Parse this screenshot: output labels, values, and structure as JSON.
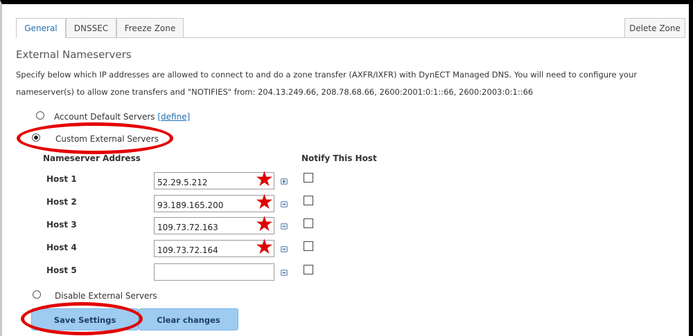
{
  "tabs": [
    {
      "label": "General",
      "active": true
    },
    {
      "label": "DNSSEC",
      "active": false
    },
    {
      "label": "Freeze Zone",
      "active": false
    }
  ],
  "delete_zone_label": "Delete Zone",
  "section": {
    "title": "External Nameservers",
    "description_line1": "Specify below which IP addresses are allowed to connect to and do a zone transfer (AXFR/IXFR) with DynECT Managed DNS. You will need to configure your",
    "description_line2": "nameserver(s) to allow zone transfers and \"NOTIFIES\" from: 204.13.249.66, 208.78.68.66, 2600:2001:0:1::66, 2600:2003:0:1::66"
  },
  "options": {
    "account_default": {
      "label": "Account Default Servers",
      "link": "[define]",
      "checked": false
    },
    "custom_external": {
      "label": "Custom External Servers",
      "checked": true
    },
    "disable_external": {
      "label": "Disable External Servers",
      "checked": false
    }
  },
  "table": {
    "col_address": "Nameserver Address",
    "col_notify": "Notify This Host",
    "hosts": [
      {
        "label": "Host 1",
        "value": "52.29.5.212",
        "icon": "add-icon",
        "notify": false,
        "starred": true
      },
      {
        "label": "Host 2",
        "value": "93.189.165.200",
        "icon": "remove-icon",
        "notify": false,
        "starred": true
      },
      {
        "label": "Host 3",
        "value": "109.73.72.163",
        "icon": "remove-icon",
        "notify": false,
        "starred": true
      },
      {
        "label": "Host 4",
        "value": "109.73.72.164",
        "icon": "remove-icon",
        "notify": false,
        "starred": true
      },
      {
        "label": "Host 5",
        "value": "",
        "icon": "remove-icon",
        "notify": false,
        "starred": false
      }
    ]
  },
  "buttons": {
    "save": "Save Settings",
    "clear": "Clear changes"
  },
  "colors": {
    "annotation_red": "#e30000",
    "link_blue": "#1f6fb2",
    "button_blue": "#9ecbf2"
  }
}
